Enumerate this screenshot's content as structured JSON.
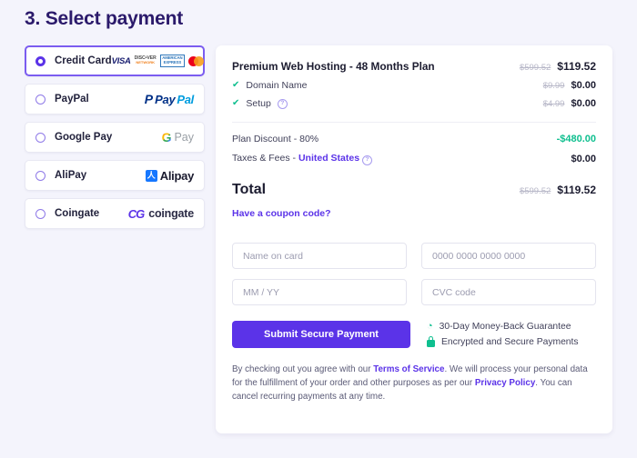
{
  "page": {
    "title": "3. Select payment",
    "accent_color": "#5b33e8",
    "background_color": "#f4f4fc",
    "success_color": "#0fbf8f"
  },
  "payment_methods": [
    {
      "label": "Credit Card",
      "selected": true,
      "logo": "credit-cards-logos"
    },
    {
      "label": "PayPal",
      "selected": false,
      "logo": "paypal-logo"
    },
    {
      "label": "Google Pay",
      "selected": false,
      "logo": "google-pay-logo"
    },
    {
      "label": "AliPay",
      "selected": false,
      "logo": "alipay-logo"
    },
    {
      "label": "Coingate",
      "selected": false,
      "logo": "coingate-logo"
    }
  ],
  "card_brands": {
    "visa": "VISA",
    "discover_line1": "DISC•VER",
    "discover_line2": "NETWORK",
    "amex_line1": "AMERICAN",
    "amex_line2": "EXPRESS"
  },
  "brand_text": {
    "paypal_p": "P",
    "paypal_pay": "Pay",
    "paypal_pal": "Pal",
    "google_g": "G",
    "google_pay": "Pay",
    "alipay_glyph": "人",
    "alipay_text": "Alipay",
    "coingate_mark": "CG",
    "coingate_text": "coingate"
  },
  "order": {
    "plan_title": "Premium Web Hosting - 48 Months Plan",
    "plan_old_price": "$599.52",
    "plan_new_price": "$119.52",
    "features": [
      {
        "label": "Domain Name",
        "old_price": "$9.99",
        "new_price": "$0.00",
        "has_tooltip": false
      },
      {
        "label": "Setup",
        "old_price": "$4.99",
        "new_price": "$0.00",
        "has_tooltip": true
      }
    ],
    "discount_label": "Plan Discount - 80%",
    "discount_value": "-$480.00",
    "taxes_label_prefix": "Taxes & Fees - ",
    "taxes_link": "United States",
    "taxes_value": "$0.00",
    "total_label": "Total",
    "total_old_price": "$599.52",
    "total_new_price": "$119.52",
    "coupon_link": "Have a coupon code?"
  },
  "form": {
    "name_on_card_placeholder": "Name on card",
    "card_number_placeholder": "0000 0000 0000 0000",
    "expiry_placeholder": "MM / YY",
    "cvc_placeholder": "CVC code",
    "submit_label": "Submit Secure Payment"
  },
  "trust": {
    "guarantee": "30-Day Money-Back Guarantee",
    "encrypted": "Encrypted and Secure Payments",
    "clock_glyph": "◔"
  },
  "legal": {
    "part1": "By checking out you agree with our ",
    "terms_link": "Terms of Service",
    "part2": ". We will process your personal data for the fulfillment of your order and other purposes as per our ",
    "privacy_link": "Privacy Policy",
    "part3": ". You can cancel recurring payments at any time."
  }
}
